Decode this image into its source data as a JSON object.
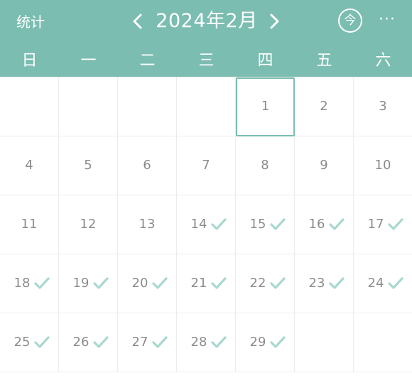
{
  "header": {
    "stats_label": "统计",
    "month_title": "2024年2月",
    "today_label": "今",
    "more_label": "···"
  },
  "weekdays": [
    "日",
    "一",
    "二",
    "三",
    "四",
    "五",
    "六"
  ],
  "calendar": {
    "selected_day": 1,
    "rows": [
      [
        {
          "day": ""
        },
        {
          "day": ""
        },
        {
          "day": ""
        },
        {
          "day": ""
        },
        {
          "day": "1",
          "checked": false,
          "selected": true
        },
        {
          "day": "2",
          "checked": false
        },
        {
          "day": "3",
          "checked": false
        }
      ],
      [
        {
          "day": "4",
          "checked": false
        },
        {
          "day": "5",
          "checked": false
        },
        {
          "day": "6",
          "checked": false
        },
        {
          "day": "7",
          "checked": false
        },
        {
          "day": "8",
          "checked": false
        },
        {
          "day": "9",
          "checked": false
        },
        {
          "day": "10",
          "checked": false
        }
      ],
      [
        {
          "day": "11",
          "checked": false
        },
        {
          "day": "12",
          "checked": false
        },
        {
          "day": "13",
          "checked": false
        },
        {
          "day": "14",
          "checked": true
        },
        {
          "day": "15",
          "checked": true
        },
        {
          "day": "16",
          "checked": true
        },
        {
          "day": "17",
          "checked": true
        }
      ],
      [
        {
          "day": "18",
          "checked": true
        },
        {
          "day": "19",
          "checked": true
        },
        {
          "day": "20",
          "checked": true
        },
        {
          "day": "21",
          "checked": true
        },
        {
          "day": "22",
          "checked": true
        },
        {
          "day": "23",
          "checked": true
        },
        {
          "day": "24",
          "checked": true
        }
      ],
      [
        {
          "day": "25",
          "checked": true
        },
        {
          "day": "26",
          "checked": true
        },
        {
          "day": "27",
          "checked": true
        },
        {
          "day": "28",
          "checked": true
        },
        {
          "day": "29",
          "checked": true
        },
        {
          "day": ""
        },
        {
          "day": ""
        }
      ]
    ]
  },
  "colors": {
    "accent": "#7bbdb1",
    "check": "#a9d8d0",
    "day_text": "#8c8c8c",
    "grid_line": "#ececec"
  },
  "icons": {
    "prev": "chevron-left-icon",
    "next": "chevron-right-icon",
    "check": "checkmark-icon"
  }
}
